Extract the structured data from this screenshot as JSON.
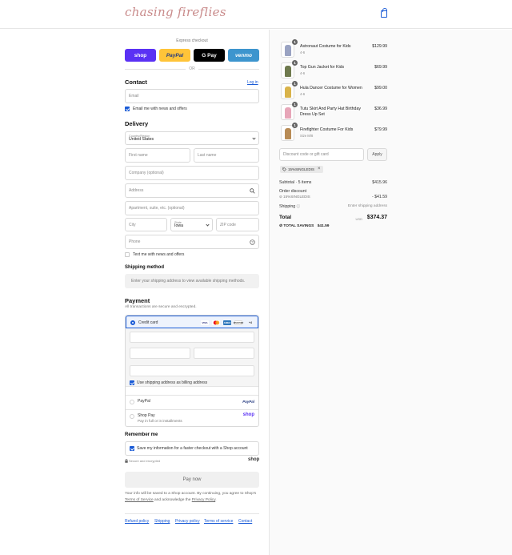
{
  "header": {
    "logo_text": "chasing fireflies",
    "cart_icon": "shopping-bag-icon"
  },
  "express": {
    "label": "Express checkout",
    "buttons": [
      {
        "label": "shop",
        "color": "#5a31f4"
      },
      {
        "label": "PayPal",
        "color": "#ffc439"
      },
      {
        "label": "G Pay",
        "color": "#000000"
      },
      {
        "label": "venmo",
        "color": "#3d95ce"
      }
    ],
    "or": "OR"
  },
  "contact": {
    "title": "Contact",
    "login": "Log in",
    "email_placeholder": "Email",
    "news_label": "Email me with news and offers"
  },
  "delivery": {
    "title": "Delivery",
    "country_label": "Country/Region",
    "country_value": "United States",
    "first_name": "First name",
    "last_name": "Last name",
    "company": "Company (optional)",
    "address": "Address",
    "apartment": "Apartment, suite, etc. (optional)",
    "city": "City",
    "state_label": "State",
    "state_value": "Iowa",
    "zip": "ZIP code",
    "phone": "Phone",
    "text_news": "Text me with news and offers"
  },
  "shipping": {
    "title": "Shipping method",
    "notice": "Enter your shipping address to view available shipping methods."
  },
  "payment": {
    "title": "Payment",
    "subtitle": "All transactions are secure and encrypted.",
    "credit_card": "Credit card",
    "card_logos": [
      "VISA",
      "MC",
      "AMEX",
      "DISCOVER",
      "+4"
    ],
    "billing_same": "Use shipping address as billing address",
    "paypal": "PayPal",
    "shoppay": "Shop Pay",
    "shoppay_sub": "Pay in full or in installments",
    "shop_logo": "shop"
  },
  "remember": {
    "title": "Remember me",
    "save_info": "Save my information for a faster checkout with a Shop account",
    "secure": "Secure and encrypted",
    "shop_logo": "shop"
  },
  "pay_now": "Pay now",
  "legal": {
    "pre": "Your info will be saved to a Shop account. By continuing, you agree to Shop's ",
    "tos": "Terms of Service",
    "mid": " and acknowledge the ",
    "privacy": "Privacy Policy",
    "post": "."
  },
  "footer_links": [
    "Refund policy",
    "Shipping",
    "Privacy policy",
    "Terms of service",
    "Contact"
  ],
  "cart": {
    "items": [
      {
        "name": "Astronaut Costume for Kids",
        "variant": "4-6",
        "price": "$129.99",
        "qty": "1",
        "color": "#9aa3c2"
      },
      {
        "name": "Top Gun Jacket for Kids",
        "variant": "4-6",
        "price": "$69.99",
        "qty": "1",
        "color": "#6f7a4e"
      },
      {
        "name": "Hula Dancer Costume for Women",
        "variant": "4-6",
        "price": "$99.00",
        "qty": "1",
        "color": "#d9b34a"
      },
      {
        "name": "Tutu Skirt And Party Hat Birthday Dress Up Set",
        "variant": "",
        "price": "$36.99",
        "qty": "1",
        "color": "#e7a6b8"
      },
      {
        "name": "Firefighter Costume For Kids",
        "variant": "Size M/8",
        "price": "$79.99",
        "qty": "1",
        "color": "#b88b55"
      }
    ],
    "discount_placeholder": "Discount code or gift card",
    "apply": "Apply",
    "code_tag": "15%SINGLEDIS",
    "subtotal_label": "Subtotal · 5 items",
    "subtotal_value": "$415.96",
    "order_discount_label": "Order discount",
    "discount_code": "15%SINGLEDIS",
    "discount_value": "- $41.59",
    "shipping_label": "Shipping",
    "shipping_value": "Enter shipping address",
    "total_label": "Total",
    "currency": "USD",
    "total_value": "$374.37",
    "savings_label": "TOTAL SAVINGS",
    "savings_value": "$41.59"
  }
}
